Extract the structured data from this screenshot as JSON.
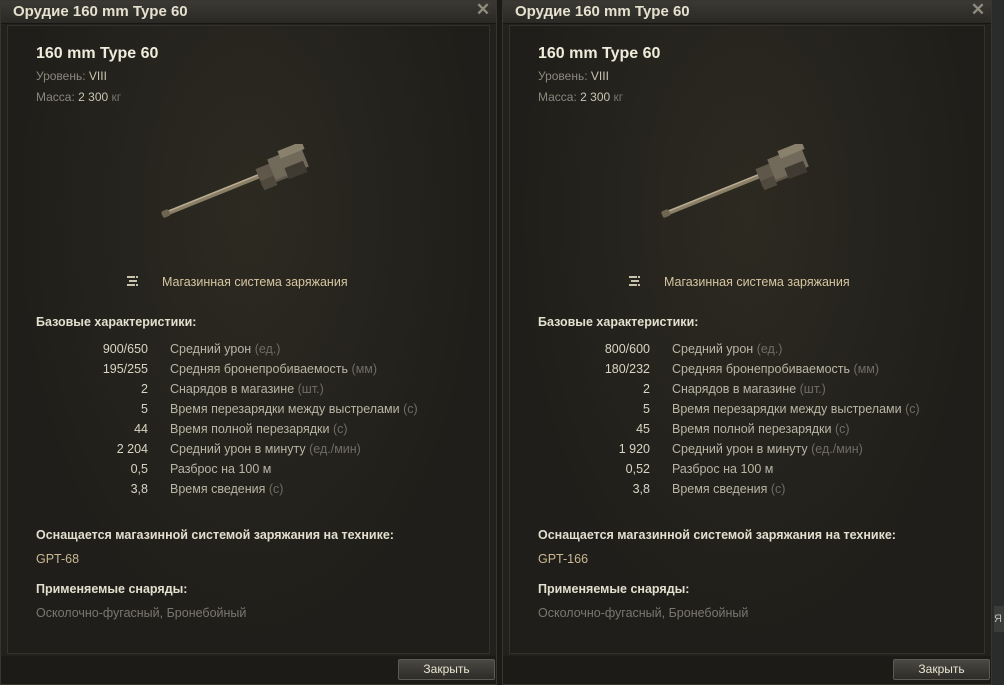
{
  "panels": [
    {
      "title": "Орудие 160 mm Type 60",
      "name": "160 mm Type 60",
      "level_label": "Уровень:",
      "level_value": "VIII",
      "mass_label": "Масса:",
      "mass_value": "2 300",
      "mass_unit": "кг",
      "loader_label": "Магазинная система заряжания",
      "base_title": "Базовые характеристики:",
      "stats": [
        {
          "value": "900/650",
          "label": "Средний урон",
          "unit": "(ед.)"
        },
        {
          "value": "195/255",
          "label": "Средняя бронепробиваемость",
          "unit": "(мм)"
        },
        {
          "value": "2",
          "label": "Снарядов в магазине",
          "unit": "(шт.)"
        },
        {
          "value": "5",
          "label": "Время перезарядки между выстрелами",
          "unit": "(с)"
        },
        {
          "value": "44",
          "label": "Время полной перезарядки",
          "unit": "(с)"
        },
        {
          "value": "2 204",
          "label": "Средний урон в минуту",
          "unit": "(ед./мин)"
        },
        {
          "value": "0,5",
          "label": "Разброс на 100 м",
          "unit": ""
        },
        {
          "value": "3,8",
          "label": "Время сведения",
          "unit": "(с)"
        }
      ],
      "equip_title": "Оснащается магазинной системой заряжания на технике:",
      "vehicle": "GPT-68",
      "shells_title": "Применяемые снаряды:",
      "shells": "Осколочно-фугасный, Бронебойный",
      "close_label": "Закрыть"
    },
    {
      "title": "Орудие 160 mm Type 60",
      "name": "160 mm Type 60",
      "level_label": "Уровень:",
      "level_value": "VIII",
      "mass_label": "Масса:",
      "mass_value": "2 300",
      "mass_unit": "кг",
      "loader_label": "Магазинная система заряжания",
      "base_title": "Базовые характеристики:",
      "stats": [
        {
          "value": "800/600",
          "label": "Средний урон",
          "unit": "(ед.)"
        },
        {
          "value": "180/232",
          "label": "Средняя бронепробиваемость",
          "unit": "(мм)"
        },
        {
          "value": "2",
          "label": "Снарядов в магазине",
          "unit": "(шт.)"
        },
        {
          "value": "5",
          "label": "Время перезарядки между выстрелами",
          "unit": "(с)"
        },
        {
          "value": "45",
          "label": "Время полной перезарядки",
          "unit": "(с)"
        },
        {
          "value": "1 920",
          "label": "Средний урон в минуту",
          "unit": "(ед./мин)"
        },
        {
          "value": "0,52",
          "label": "Разброс на 100 м",
          "unit": ""
        },
        {
          "value": "3,8",
          "label": "Время сведения",
          "unit": "(с)"
        }
      ],
      "equip_title": "Оснащается магазинной системой заряжания на технике:",
      "vehicle": "GPT-166",
      "shells_title": "Применяемые снаряды:",
      "shells": "Осколочно-фугасный, Бронебойный",
      "close_label": "Закрыть"
    }
  ],
  "background_edge_text": "Я",
  "icons": {
    "gun": "gun-image",
    "loader": "autoloader-icon",
    "close": "close-icon"
  }
}
